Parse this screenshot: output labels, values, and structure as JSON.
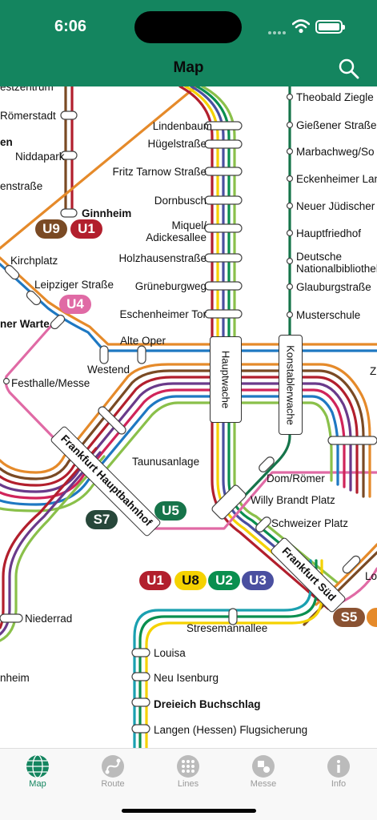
{
  "status_bar": {
    "time": "6:06"
  },
  "header": {
    "title": "Map",
    "search_icon": "search-icon"
  },
  "colors": {
    "brand": "#14855f",
    "U1": "#b21f2d",
    "U2": "#0a8f4f",
    "U3": "#4a4fa0",
    "U4": "#e06aa5",
    "U5": "#16744a",
    "U8": "#f5d200",
    "U9": "#7a4a24",
    "S5": "#8a5232",
    "S7": "#27473a"
  },
  "stations": {
    "estzentrum": "estzentrum",
    "roemerstadt": "Römerstadt",
    "en": "en",
    "niddapark": "Niddapark",
    "enstrasse": "enstraße",
    "ginnheim": "Ginnheim",
    "kirchplatz": "Kirchplatz",
    "leipziger": "Leipziger Straße",
    "bockenheimer_warte": "ner Warte",
    "festhalle": "Festhalle/Messe",
    "westend": "Westend",
    "alte_oper": "Alte Oper",
    "lindenbaum": "Lindenbaum",
    "huegel": "Hügelstraße",
    "fritz_tarnow": "Fritz Tarnow Straße",
    "dornbusch": "Dornbusch",
    "miquel": "Miquel/\nAdickesallee",
    "holzhausen": "Holzhausenstraße",
    "grueneburgweg": "Grüneburgweg",
    "eschenheimer_tor": "Eschenheimer Tor",
    "hauptwache": "Hauptwache",
    "konstablerwache": "Konstablerwache",
    "theobald": "Theobald Ziegle",
    "giessener": "Gießener Straße",
    "marbachweg": "Marbachweg/So",
    "eckenheimer": "Eckenheimer Lan",
    "neuer_juedischer": "Neuer Jüdischer",
    "hauptfriedhof": "Hauptfriedhof",
    "nationalbibliothek": "Deutsche\nNationalbibliothek",
    "glauburg": "Glauburgstraße",
    "musterschule": "Musterschule",
    "z": "Z",
    "taunusanlage": "Taunusanlage",
    "hauptbahnhof": "Frankfurt Hauptbahnhof",
    "dom_roemer": "Dom/Römer",
    "willy_brandt": "Willy Brandt Platz",
    "schweizer": "Schweizer Platz",
    "sued": "Frankfurt Süd",
    "lo": "Lo",
    "niederrad": "Niederrad",
    "nheim": "nheim",
    "stresemann": "Stresemannallee",
    "louisa": "Louisa",
    "neu_isenburg": "Neu Isenburg",
    "dreieich": "Dreieich Buchschlag",
    "langen": "Langen (Hessen) Flugsicherung"
  },
  "badges": {
    "u9": "U9",
    "u1a": "U1",
    "u4": "U4",
    "s7": "S7",
    "u5": "U5",
    "u1b": "U1",
    "u8": "U8",
    "u2": "U2",
    "u3": "U3",
    "s5": "S5"
  },
  "tabs": [
    {
      "label": "Map",
      "icon": "globe-icon",
      "active": true
    },
    {
      "label": "Route",
      "icon": "route-icon",
      "active": false
    },
    {
      "label": "Lines",
      "icon": "lines-grid-icon",
      "active": false
    },
    {
      "label": "Messe",
      "icon": "messe-icon",
      "active": false
    },
    {
      "label": "Info",
      "icon": "info-icon",
      "active": false
    }
  ]
}
